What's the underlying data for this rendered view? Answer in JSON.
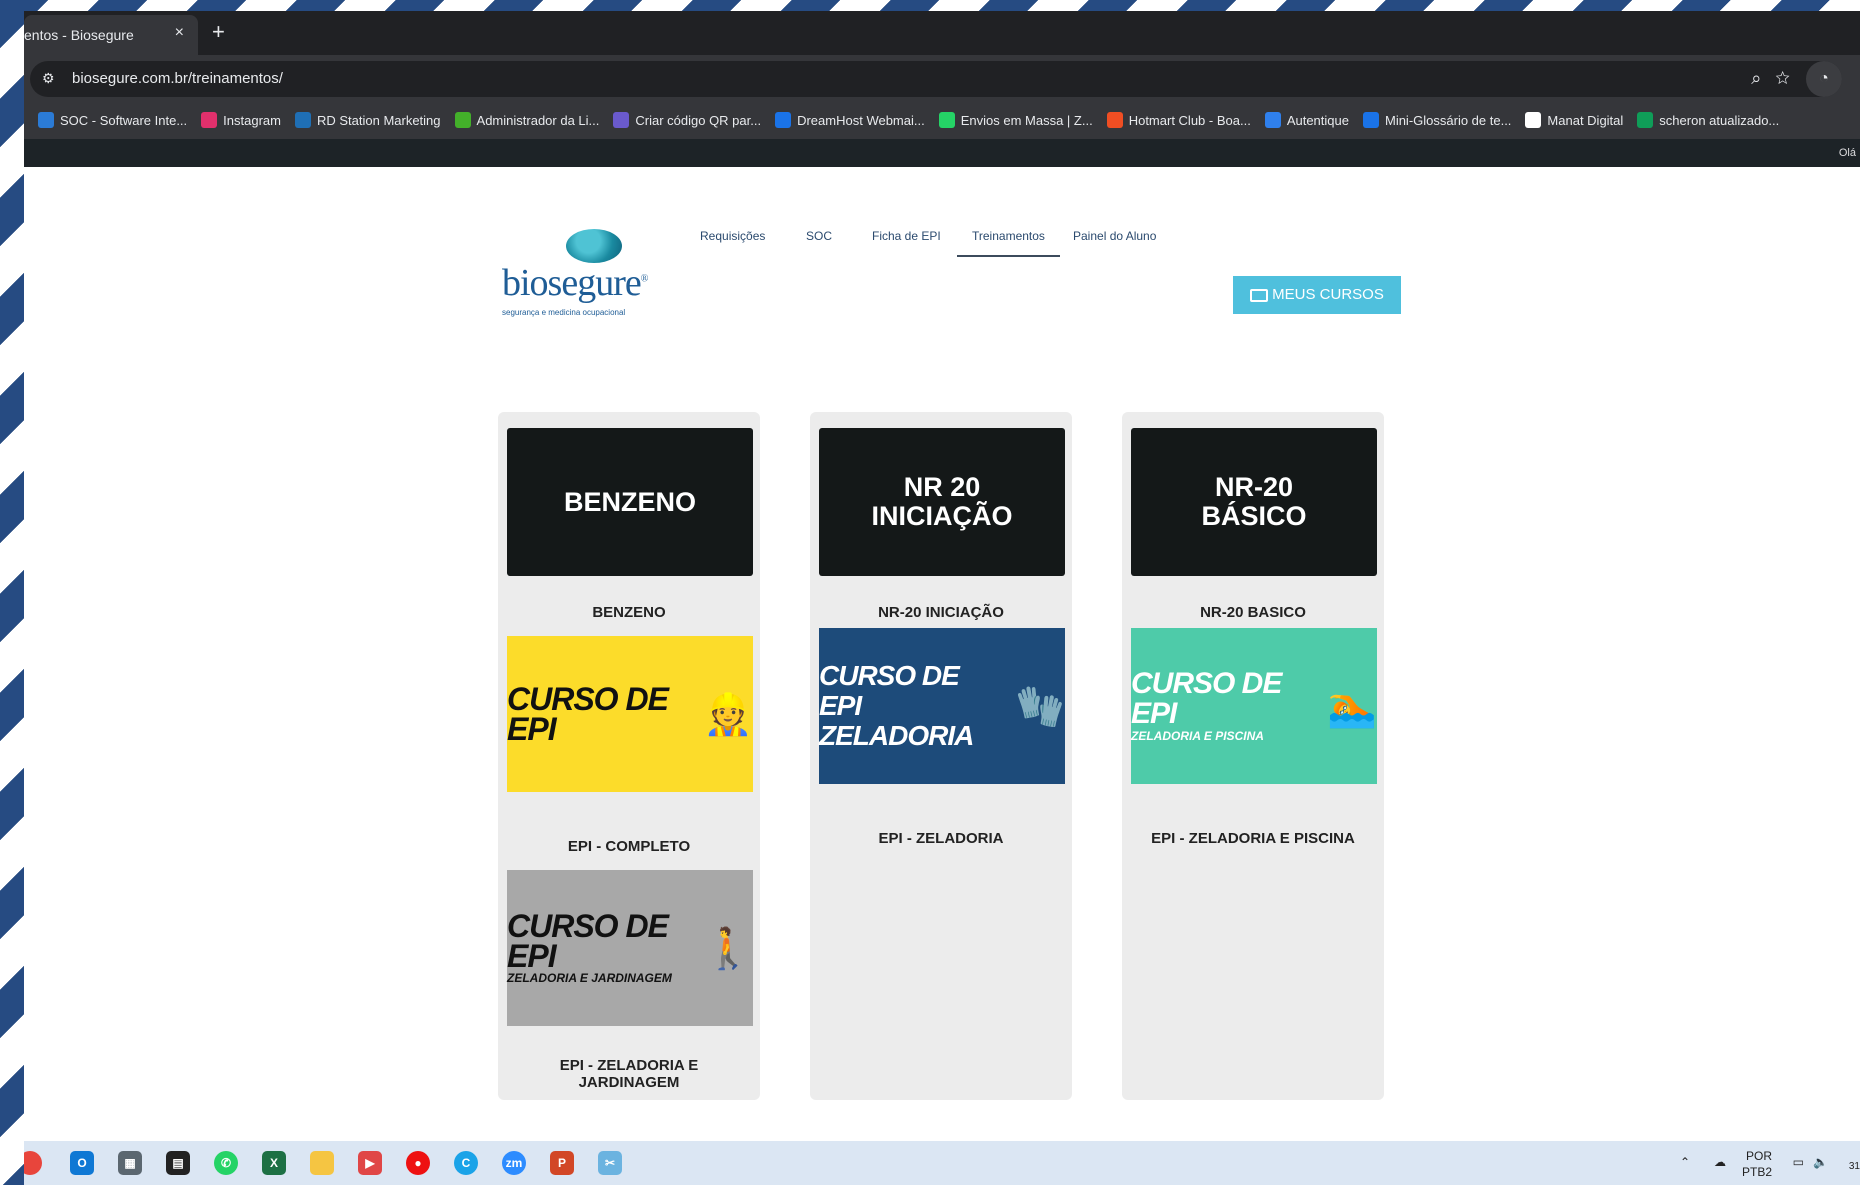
{
  "browser": {
    "tab_title": "entos - Biosegure",
    "tab_close": "×",
    "new_tab": "+",
    "url": "biosegure.com.br/treinamentos/",
    "bookmarks": [
      {
        "label": "SOC - Software Inte...",
        "color": "#2b7bd6"
      },
      {
        "label": "Instagram",
        "color": "#e1306c"
      },
      {
        "label": "RD Station Marketing",
        "color": "#1f6fb5"
      },
      {
        "label": "Administrador da Li...",
        "color": "#43b02a"
      },
      {
        "label": "Criar código QR par...",
        "color": "#6a5acd"
      },
      {
        "label": "DreamHost Webmai...",
        "color": "#1a73e8"
      },
      {
        "label": "Envios em Massa | Z...",
        "color": "#25d366"
      },
      {
        "label": "Hotmart Club - Boa...",
        "color": "#f04e23"
      },
      {
        "label": "Autentique",
        "color": "#2f80ed"
      },
      {
        "label": "Mini-Glossário de te...",
        "color": "#1a73e8"
      },
      {
        "label": "Manat Digital",
        "color": "#ffffff"
      },
      {
        "label": "scheron atualizado...",
        "color": "#0f9d58"
      }
    ],
    "admin_greeting": "Olá"
  },
  "site": {
    "logo_word": "biosegure",
    "logo_tag": "segurança e medicina ocupacional",
    "nav": [
      "Requisições",
      "SOC",
      "Ficha de EPI",
      "Treinamentos",
      "Painel do Aluno"
    ],
    "cta_label": "MEUS CURSOS"
  },
  "courses": {
    "col1": [
      {
        "image_text": "BENZENO",
        "title": "BENZENO"
      },
      {
        "image_text": "CURSO DE EPI",
        "title": "EPI - COMPLETO"
      },
      {
        "image_text": "CURSO DE EPI",
        "image_sub": "ZELADORIA E JARDINAGEM",
        "title": "EPI - ZELADORIA E JARDINAGEM"
      }
    ],
    "col2": [
      {
        "image_text_1": "NR 20",
        "image_text_2": "INICIAÇÃO",
        "title": "NR-20 INICIAÇÃO"
      },
      {
        "image_text_1": "CURSO DE EPI",
        "image_text_2": "ZELADORIA",
        "title": "EPI - ZELADORIA"
      }
    ],
    "col3": [
      {
        "image_text_1": "NR-20",
        "image_text_2": "BÁSICO",
        "title": "NR-20 BASICO"
      },
      {
        "image_text": "CURSO DE EPI",
        "image_sub": "ZELADORIA E PISCINA",
        "title": "EPI - ZELADORIA E PISCINA"
      }
    ]
  },
  "taskbar": {
    "lang_1": "POR",
    "lang_2": "PTB2",
    "time": "31"
  }
}
